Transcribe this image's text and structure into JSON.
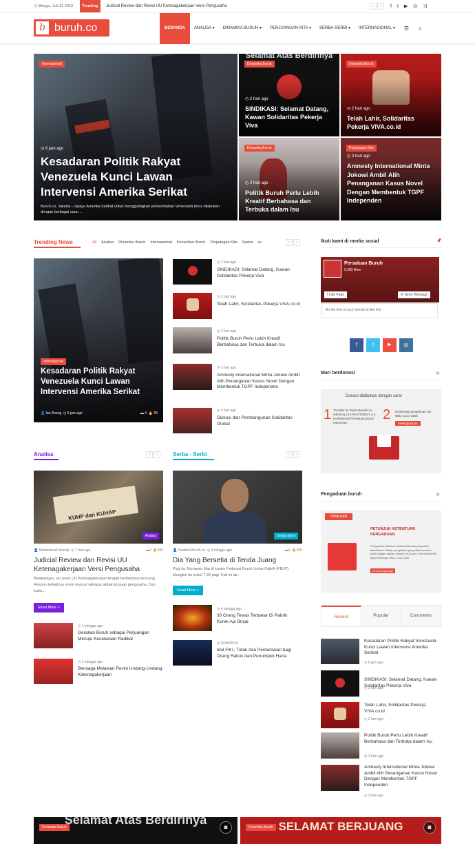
{
  "topbar": {
    "date": "Minggu, Juli 21 2019",
    "trending_label": "Trending",
    "ticker": "Judicial Review dan Revisi UU Ketenagakerjaan Versi Pengusaha",
    "social_icons": [
      "facebook-icon",
      "twitter-icon",
      "youtube-icon",
      "instagram-icon",
      "random-icon"
    ]
  },
  "header": {
    "logo_text": "buruh.co",
    "logo_mark": "b",
    "nav": [
      "BERANDA",
      "ANALISA",
      "DINAMIKA BURUH",
      "PERJUANGAN KITA",
      "SERBA-SERBI",
      "INTERNASIONAL"
    ]
  },
  "hero": {
    "main": {
      "category": "Internasional",
      "date": "6 jam ago",
      "title": "Kesadaran Politik Rakyat Venezuela Kunci Lawan Intervensi Amerika Serikat",
      "excerpt": "Buruh.co, Jakarta – Upaya Amerika Serikat untuk menggulingkan pemerintahan Venezuela terus dilakukan dengan berbagai cara...."
    },
    "tiles": [
      {
        "category": "Dinamika Buruh",
        "date": "2 hari ago",
        "title": "SINDIKASI: Selamat Datang, Kawan Solidaritas Pekerja Viva",
        "banner": "Selamat Atas Berdirinya"
      },
      {
        "category": "Dinamika Buruh",
        "date": "2 hari ago",
        "title": "Telah Lahir, Solidaritas Pekerja VIVA.co.id"
      },
      {
        "category": "Dinamika Buruh",
        "date": "2 hari ago",
        "title": "Politik Buruh Perlu Lebih Kreatif Berbahasa dan Terbuka dalam Isu"
      },
      {
        "category": "Perjuangan Kita",
        "date": "3 hari ago",
        "title": "Amnesty International Minta Jokowi Ambil Alih Penanganan Kasus Novel Dengan Membentuk TGPF Independen"
      }
    ]
  },
  "trending": {
    "title": "Trending News",
    "tabs": [
      "All",
      "Analisa",
      "Dinamika Buruh",
      "Internasional",
      "Konsultasi Buruh",
      "Perjuangan Kita",
      "Sastra"
    ],
    "main": {
      "category": "Internasional",
      "title": "Kesadaran Politik Rakyat Venezuela Kunci Lawan Intervensi Amerika Serikat",
      "author": "Ian Ahong",
      "date": "6 jam ago",
      "comments": "0",
      "views": "56"
    },
    "list": [
      {
        "date": "2 hari ago",
        "title": "SINDIKASI: Selamat Datang, Kawan Solidaritas Pekerja Viva"
      },
      {
        "date": "2 hari ago",
        "title": "Telah Lahir, Solidaritas Pekerja VIVA.co.id"
      },
      {
        "date": "2 hari ago",
        "title": "Politik Buruh Perlu Lebih Kreatif Berbahasa dan Terbuka dalam Isu"
      },
      {
        "date": "3 hari ago",
        "title": "Amnesty International Minta Jokowi Ambil Alih Penanganan Kasus Novel Dengan Membentuk TGPF Independen"
      },
      {
        "date": "4 hari ago",
        "title": "Diskusi dan Pembangunan Solidaritas Global"
      }
    ]
  },
  "analisa": {
    "title": "Analisa",
    "color": "#7b1fe0",
    "main": {
      "badge": "Analisa",
      "image_text": "KUHP dan KUHAP",
      "author": "Muhammad Muzaqi",
      "date": "7 hari ago",
      "comments": "0",
      "views": "260",
      "title": "Judicial Review dan Revisi UU Ketenagakerjaan Versi Pengusaha",
      "excerpt": "Belakangan, isu revisi UU Ketenagakerjaan tengah berhembus kencang. Respon terkait isu revisi muncul sebagai akibat kicauan pengusaha. Dari kubu...",
      "more": "Read More »"
    },
    "list": [
      {
        "date": "1 minggu ago",
        "title": "Gerakan Buruh sebagai Perjuangan Menuju Kesetaraan Radikal"
      },
      {
        "date": "1 minggu ago",
        "title": "Bersiaga Melawan Revisi Undang-Undang Ketenagakerjaan"
      }
    ]
  },
  "serba": {
    "title": "Serba - Serbi",
    "color": "#00aecd",
    "main": {
      "badge": "Serba-Serbi",
      "author": "Redaksi Buruh.co",
      "date": "3 minggu ago",
      "comments": "0",
      "views": "325",
      "title": "Dia Yang Bersetia di Tenda Juang",
      "excerpt": "Pagi itu Gunawan tiba di kantor Federasi Buruh Lintas Pabrik (FBLP). Mungkin itu pukul 7.30 pagi. Kali ini air...",
      "more": "Read More »"
    },
    "list": [
      {
        "date": "4 minggu ago",
        "title": "30 Orang Tewas Terbakar Di Pabrik Korek Api Binjai"
      },
      {
        "date": "04/06/2019",
        "title": "Idul Fitri ; Tidak Ada Perdamaian bagi Orang Rakus dan Penumpuk Harta"
      }
    ]
  },
  "sidebar": {
    "social_title": "Ikuti kami di media sosial",
    "fb_page": "Persaluan Buruh",
    "fb_likes": "9,283 likes",
    "fb_like": "Like Page",
    "fb_msg": "Send Message",
    "fb_friends": "Be the first of your friends to like this",
    "donate_title": "Mari berdonasi",
    "donate_head": "Donasi dilakukan dengan cara:",
    "donate_1": "Transfer ke Bank Mandiri no. rekening 124-00-07833227 a.n Konfederasi Persatuan Buruh Indonesia.",
    "donate_2": "Konfirmasi pengiriman via 0821-1214-2182",
    "donate_btn": "Selengkapnya",
    "complaint_title": "Pengaduan buruh",
    "complaint_tag": "PANDUAN",
    "complaint_head1": "PETUNJUK KETENTUAN",
    "complaint_head2": "PENGADUAN",
    "complaint_body": "Pengaduan diterima melalui halaman yang telah disediakan. Setiap pengaduan yang diterima akan kami pelajari dahulu selama 2X24 jam. Informasi lebih lanjut hubungi: 0812-1214-2182",
    "complaint_btn": "Kirim pengaduan",
    "tabs": [
      "Recent",
      "Popular",
      "Comments"
    ],
    "recent": [
      {
        "date": "6 jam ago",
        "title": "Kesadaran Politik Rakyat Venezuela Kunci Lawan Intervensi Amerika Serikat"
      },
      {
        "date": "2 hari ago",
        "title": "SINDIKASI: Selamat Datang, Kawan Solidaritas Pekerja Viva"
      },
      {
        "date": "2 hari ago",
        "title": "Telah Lahir, Solidaritas Pekerja VIVA.co.id"
      },
      {
        "date": "2 hari ago",
        "title": "Politik Buruh Perlu Lebih Kreatif Berbahasa dan Terbuka dalam Isu"
      },
      {
        "date": "3 hari ago",
        "title": "Amnesty International Minta Jokowi Ambil Alih Penanganan Kasus Novel Dengan Membentuk TGPF Independen"
      }
    ]
  },
  "bottom": [
    {
      "category": "Dinamika Buruh",
      "banner": "Selamat Atas Berdirinya"
    },
    {
      "category": "Dinamika Buruh",
      "banner": "SELAMAT BERJUANG"
    }
  ],
  "colors": {
    "accent": "#e74c3c",
    "analisa": "#7b1fe0",
    "serba": "#00aecd"
  }
}
